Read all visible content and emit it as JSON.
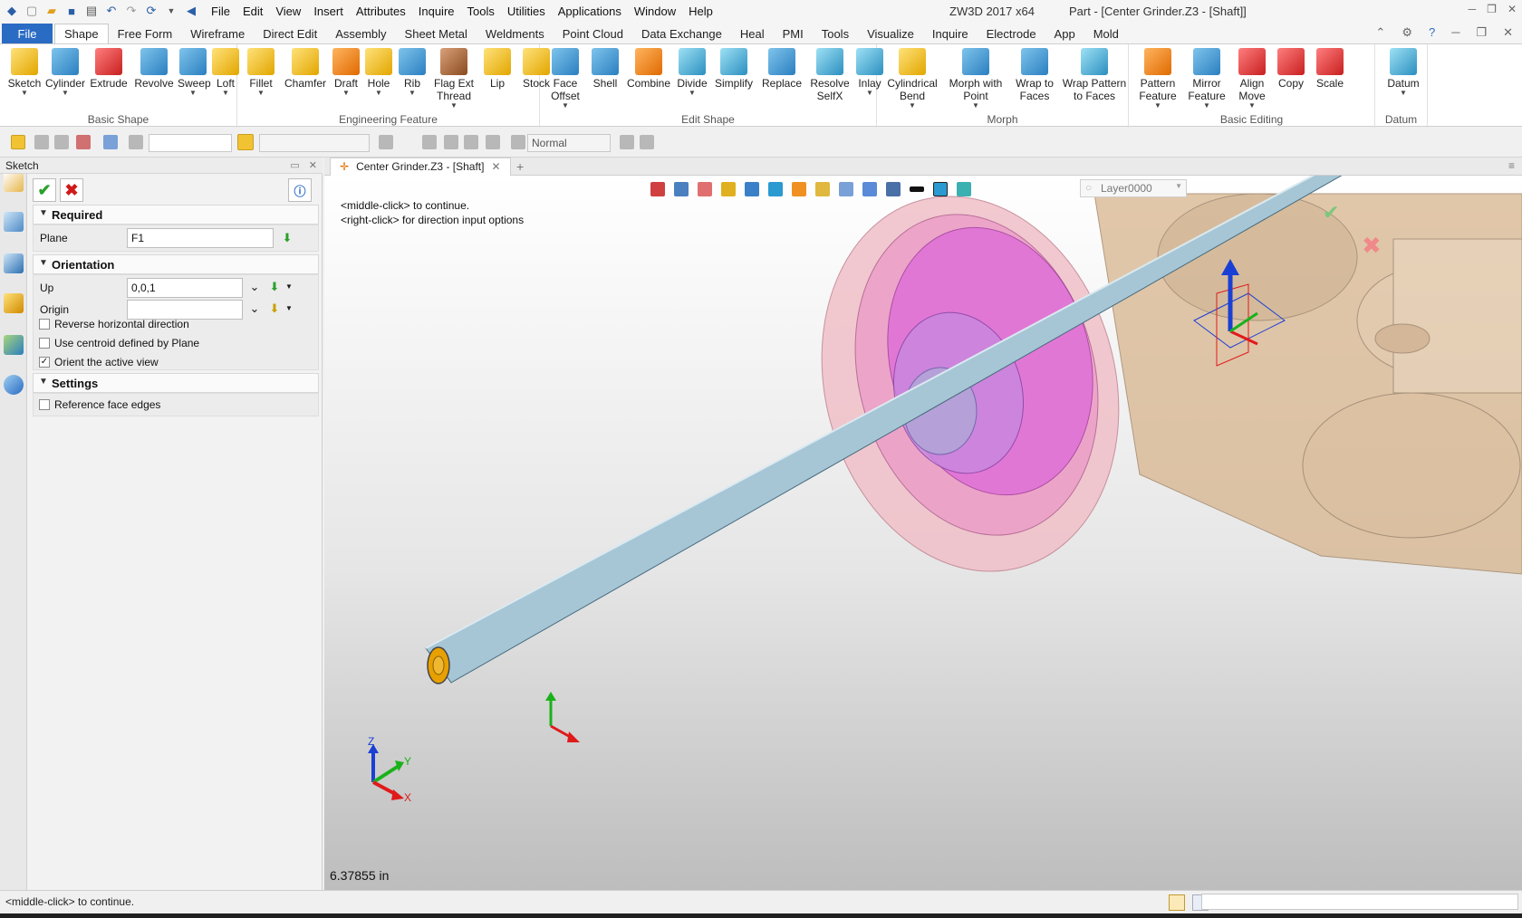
{
  "titlebar": {
    "menus": [
      "File",
      "Edit",
      "View",
      "Insert",
      "Attributes",
      "Inquire",
      "Tools",
      "Utilities",
      "Applications",
      "Window",
      "Help"
    ],
    "app_title": "ZW3D 2017  x64",
    "doc_title": "Part - [Center Grinder.Z3 - [Shaft]]"
  },
  "ribbon_tabs": {
    "file": "File",
    "tabs": [
      "Shape",
      "Free Form",
      "Wireframe",
      "Direct Edit",
      "Assembly",
      "Sheet Metal",
      "Weldments",
      "Point Cloud",
      "Data Exchange",
      "Heal",
      "PMI",
      "Tools",
      "Visualize",
      "Inquire",
      "Electrode",
      "App",
      "Mold"
    ],
    "active": "Shape"
  },
  "ribbon": {
    "groups": [
      {
        "name": "Basic Shape",
        "buttons": [
          {
            "l1": "Sketch",
            "l2": "",
            "dd": true,
            "color": "yellow"
          },
          {
            "l1": "Cylinder",
            "l2": "",
            "dd": true,
            "color": "blue"
          },
          {
            "l1": "Extrude",
            "l2": "",
            "dd": false,
            "color": "red"
          },
          {
            "l1": "Revolve",
            "l2": "",
            "dd": false,
            "color": "blue"
          },
          {
            "l1": "Sweep",
            "l2": "",
            "dd": true,
            "color": "blue"
          },
          {
            "l1": "Loft",
            "l2": "",
            "dd": true,
            "color": "yellow"
          }
        ]
      },
      {
        "name": "Engineering Feature",
        "buttons": [
          {
            "l1": "Fillet",
            "l2": "",
            "dd": true,
            "color": "yellow"
          },
          {
            "l1": "Chamfer",
            "l2": "",
            "dd": false,
            "color": "yellow"
          },
          {
            "l1": "Draft",
            "l2": "",
            "dd": true,
            "color": "orange"
          },
          {
            "l1": "Hole",
            "l2": "",
            "dd": true,
            "color": "yellow"
          },
          {
            "l1": "Rib",
            "l2": "",
            "dd": true,
            "color": "blue"
          },
          {
            "l1": "Flag Ext",
            "l2": "Thread",
            "dd": true,
            "color": "brown"
          },
          {
            "l1": "Lip",
            "l2": "",
            "dd": false,
            "color": "yellow"
          },
          {
            "l1": "Stock",
            "l2": "",
            "dd": false,
            "color": "yellow"
          }
        ]
      },
      {
        "name": "Edit Shape",
        "buttons": [
          {
            "l1": "Face",
            "l2": "Offset",
            "dd": true,
            "color": "blue"
          },
          {
            "l1": "Shell",
            "l2": "",
            "dd": false,
            "color": "blue"
          },
          {
            "l1": "Combine",
            "l2": "",
            "dd": false,
            "color": "orange"
          },
          {
            "l1": "Divide",
            "l2": "",
            "dd": true,
            "color": "teal"
          },
          {
            "l1": "Simplify",
            "l2": "",
            "dd": false,
            "color": "teal"
          },
          {
            "l1": "Replace",
            "l2": "",
            "dd": false,
            "color": "blue"
          },
          {
            "l1": "Resolve",
            "l2": "SelfX",
            "dd": false,
            "color": "teal"
          },
          {
            "l1": "Inlay",
            "l2": "",
            "dd": true,
            "color": "teal"
          }
        ]
      },
      {
        "name": "Morph",
        "buttons": [
          {
            "l1": "Cylindrical",
            "l2": "Bend",
            "dd": true,
            "color": "yellow"
          },
          {
            "l1": "Morph with",
            "l2": "Point",
            "dd": true,
            "color": "blue"
          },
          {
            "l1": "Wrap to",
            "l2": "Faces",
            "dd": false,
            "color": "blue"
          },
          {
            "l1": "Wrap Pattern",
            "l2": "to Faces",
            "dd": false,
            "color": "teal"
          }
        ]
      },
      {
        "name": "Basic Editing",
        "buttons": [
          {
            "l1": "Pattern",
            "l2": "Feature",
            "dd": true,
            "color": "orange"
          },
          {
            "l1": "Mirror",
            "l2": "Feature",
            "dd": true,
            "color": "blue"
          },
          {
            "l1": "Align",
            "l2": "Move",
            "dd": true,
            "color": "red"
          },
          {
            "l1": "Copy",
            "l2": "",
            "dd": false,
            "color": "red"
          },
          {
            "l1": "Scale",
            "l2": "",
            "dd": false,
            "color": "red"
          }
        ]
      },
      {
        "name": "Datum",
        "buttons": [
          {
            "l1": "Datum",
            "l2": "",
            "dd": true,
            "color": "teal"
          }
        ]
      }
    ]
  },
  "toolbar2": {
    "render_mode": "Normal"
  },
  "panel": {
    "title": "Sketch",
    "required_label": "Required",
    "plane_label": "Plane",
    "plane_value": "F1",
    "orientation_label": "Orientation",
    "up_label": "Up",
    "up_value": "0,0,1",
    "origin_label": "Origin",
    "origin_value": "",
    "reverse_label": "Reverse horizontal direction",
    "reverse_checked": false,
    "centroid_label": "Use centroid defined by Plane",
    "centroid_checked": false,
    "orient_label": "Orient the active view",
    "orient_checked": true,
    "settings_label": "Settings",
    "ref_label": "Reference face edges",
    "ref_checked": false
  },
  "doctab": {
    "label": "Center Grinder.Z3 - [Shaft]"
  },
  "viewport": {
    "prompt_line1": "<middle-click> to continue.",
    "prompt_line2": "<right-click> for direction input options",
    "measurement": "6.37855 in",
    "layer": "Layer0000",
    "axis_x": "X",
    "axis_y": "Y",
    "axis_z": "Z"
  },
  "status": {
    "message": "<middle-click> to continue."
  },
  "colors": {
    "file_tab": "#2a6bc4",
    "shaft": "#a6c6d6",
    "wheel": "#e070d8",
    "housing": "#d8b58e",
    "triad_blue": "#1a3fd4",
    "triad_red": "#e01a1a",
    "triad_green": "#1ab21a"
  }
}
